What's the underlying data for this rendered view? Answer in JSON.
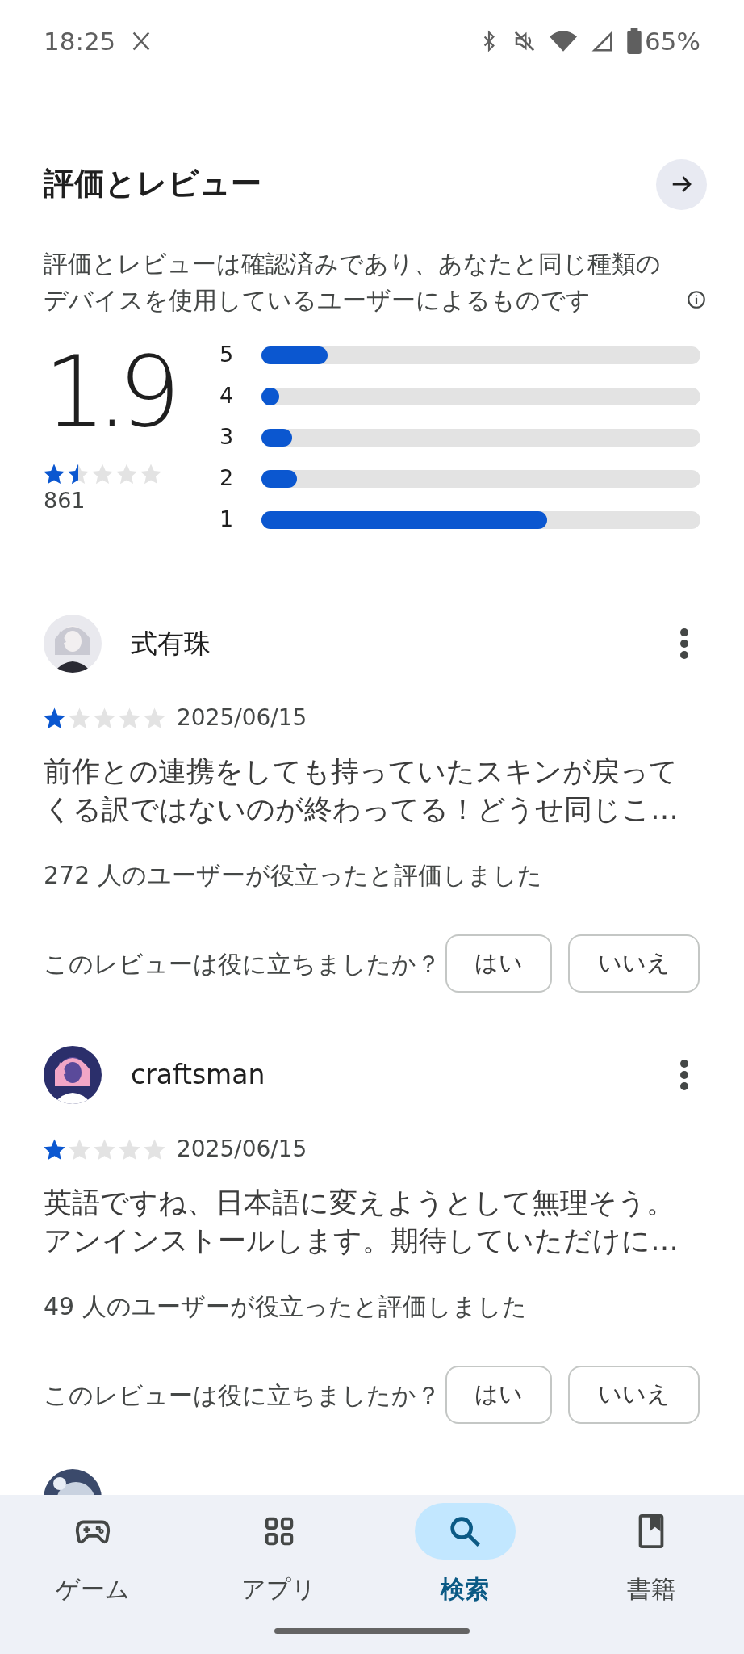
{
  "status_bar": {
    "time": "18:25",
    "battery": "65%"
  },
  "section": {
    "title": "評価とレビュー",
    "description": "評価とレビューは確認済みであり、あなたと同じ種類のデバイスを使用しているユーザーによるものです"
  },
  "summary": {
    "score": "1.9",
    "stars": 1.5,
    "count": "861"
  },
  "distribution": [
    {
      "label": "5",
      "level": 0.15
    },
    {
      "label": "4",
      "level": 0.03
    },
    {
      "label": "3",
      "level": 0.07
    },
    {
      "label": "2",
      "level": 0.08
    },
    {
      "label": "1",
      "level": 0.65
    }
  ],
  "reviews": [
    {
      "name": "式有珠",
      "stars": 1,
      "date": "2025/06/15",
      "text": "前作との連携をしても持っていたスキンが戻ってくる訳ではないのが終わってる！どうせ同じこ…",
      "helpful": "272 人のユーザーが役立ったと評価しました",
      "question": "このレビューは役に立ちましたか？",
      "yes": "はい",
      "no": "いいえ"
    },
    {
      "name": "craftsman",
      "stars": 1,
      "date": "2025/06/15",
      "text": "英語ですね、日本語に変えようとして無理そう。アンインストールします。期待していただけに…",
      "helpful": "49 人のユーザーが役立ったと評価しました",
      "question": "このレビューは役に立ちましたか？",
      "yes": "はい",
      "no": "いいえ"
    }
  ],
  "nav": [
    {
      "label": "ゲーム",
      "selected": false
    },
    {
      "label": "アプリ",
      "selected": false
    },
    {
      "label": "検索",
      "selected": true
    },
    {
      "label": "書籍",
      "selected": false
    }
  ]
}
